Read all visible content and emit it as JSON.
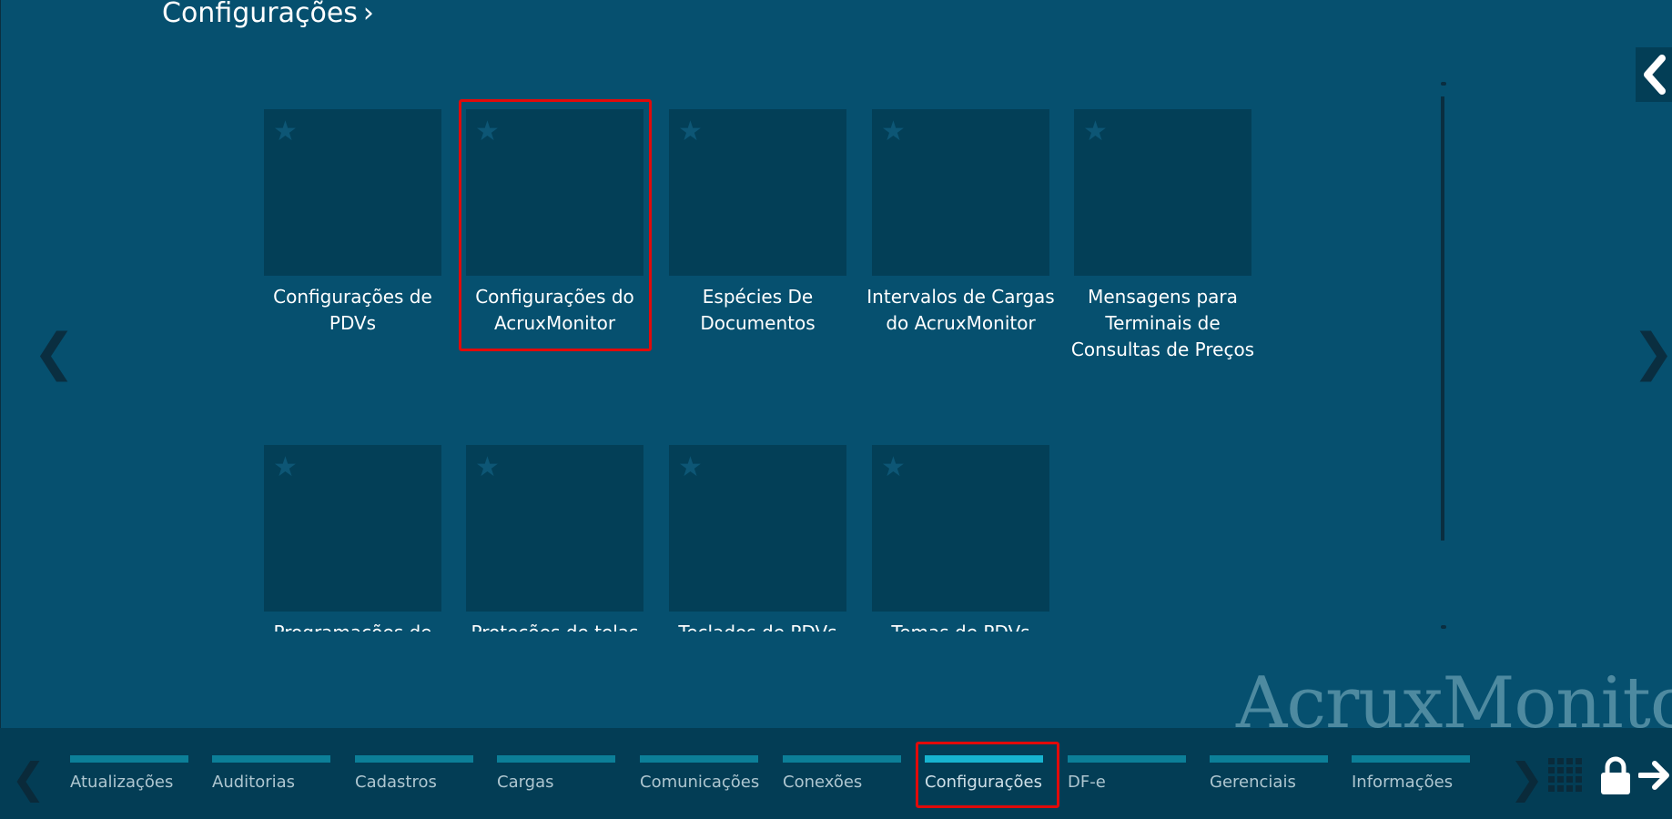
{
  "header": {
    "title": "Configurações",
    "chevron": "›"
  },
  "icons": {
    "collapse": "chevron-left-icon",
    "star": "star-icon",
    "grid": "grid-icon",
    "lock": "lock-icon",
    "logout": "arrow-right-icon"
  },
  "navigation": {
    "prev": "❮",
    "next": "❯"
  },
  "tiles": [
    {
      "label": "Configurações de PDVs",
      "star": "★"
    },
    {
      "label": "Configurações do AcruxMonitor",
      "star": "★"
    },
    {
      "label": "Espécies De Documentos",
      "star": "★"
    },
    {
      "label": "Intervalos de Cargas do AcruxMonitor",
      "star": "★"
    },
    {
      "label": "Mensagens para Terminais de Consultas de Preços",
      "star": "★"
    },
    {
      "label": "Programações de",
      "star": "★"
    },
    {
      "label": "Proteções de telas",
      "star": "★"
    },
    {
      "label": "Teclados de PDVs",
      "star": "★"
    },
    {
      "label": "Temas de PDVs",
      "star": "★"
    }
  ],
  "watermark": "AcruxMonitor",
  "bottom_bar": {
    "prev": "❮",
    "next": "❯",
    "tabs": [
      {
        "label": "Atualizações"
      },
      {
        "label": "Auditorias"
      },
      {
        "label": "Cadastros"
      },
      {
        "label": "Cargas"
      },
      {
        "label": "Comunicações"
      },
      {
        "label": "Conexões"
      },
      {
        "label": "Configurações",
        "active": true
      },
      {
        "label": "DF-e"
      },
      {
        "label": "Gerenciais"
      },
      {
        "label": "Informações"
      }
    ]
  },
  "colors": {
    "background": "#06506f",
    "tile": "#033f57",
    "bottom_bar": "#033d55",
    "tab_bar": "#0c7f98",
    "tab_bar_active": "#17b4d0",
    "highlight": "#e10a0a"
  }
}
